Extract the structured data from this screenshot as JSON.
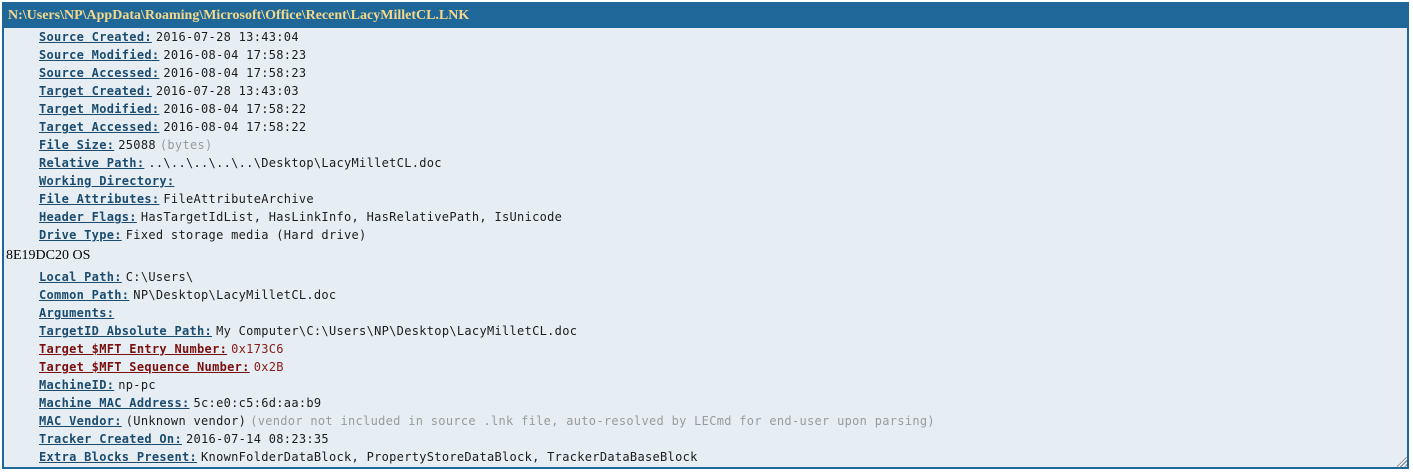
{
  "window": {
    "title": "N:\\Users\\NP\\AppData\\Roaming\\Microsoft\\Office\\Recent\\LacyMilletCL.LNK"
  },
  "fields_top": [
    {
      "key": "Source Created:",
      "value": "2016-07-28 13:43:04"
    },
    {
      "key": "Source Modified:",
      "value": "2016-08-04 17:58:23"
    },
    {
      "key": "Source Accessed:",
      "value": "2016-08-04 17:58:23"
    },
    {
      "key": "Target Created:",
      "value": "2016-07-28 13:43:03"
    },
    {
      "key": "Target Modified:",
      "value": "2016-08-04 17:58:22"
    },
    {
      "key": "Target Accessed:",
      "value": "2016-08-04 17:58:22"
    },
    {
      "key": "File Size:",
      "value": "25088",
      "unit": "(bytes)"
    },
    {
      "key": "Relative Path:",
      "value": "..\\..\\..\\..\\..\\Desktop\\LacyMilletCL.doc"
    },
    {
      "key": "Working Directory:",
      "value": ""
    },
    {
      "key": "File Attributes:",
      "value": "FileAttributeArchive"
    },
    {
      "key": "Header Flags:",
      "value": "HasTargetIdList, HasLinkInfo, HasRelativePath, IsUnicode"
    },
    {
      "key": "Drive Type:",
      "value": "Fixed storage media (Hard drive)"
    }
  ],
  "volume_line": "8E19DC20 OS",
  "fields_bottom": [
    {
      "key": "Local Path:",
      "value": "C:\\Users\\"
    },
    {
      "key": "Common Path:",
      "value": "NP\\Desktop\\LacyMilletCL.doc"
    },
    {
      "key": "Arguments:",
      "value": ""
    },
    {
      "key": "TargetID Absolute Path:",
      "value": "My Computer\\C:\\Users\\NP\\Desktop\\LacyMilletCL.doc"
    },
    {
      "key": "Target $MFT Entry Number:",
      "value": "0x173C6"
    },
    {
      "key": "Target $MFT Sequence Number:",
      "value": "0x2B"
    },
    {
      "key": "MachineID:",
      "value": "np-pc"
    },
    {
      "key": "Machine MAC Address:",
      "value": "5c:e0:c5:6d:aa:b9"
    },
    {
      "key": "MAC Vendor:",
      "value": "(Unknown vendor)",
      "note": "(vendor not included in source .lnk file, auto-resolved by LECmd for end-user upon parsing)"
    },
    {
      "key": "Tracker Created On:",
      "value": "2016-07-14 08:23:35"
    },
    {
      "key": "Extra Blocks Present:",
      "value": "KnownFolderDataBlock, PropertyStoreDataBlock, TrackerDataBaseBlock"
    }
  ],
  "colors": {
    "title_bg": "#1f6799",
    "title_text": "#f4d98a",
    "panel_bg": "#e7eef3",
    "key_text": "#1b4b6e",
    "alert_key_text": "#7a0f0f"
  }
}
